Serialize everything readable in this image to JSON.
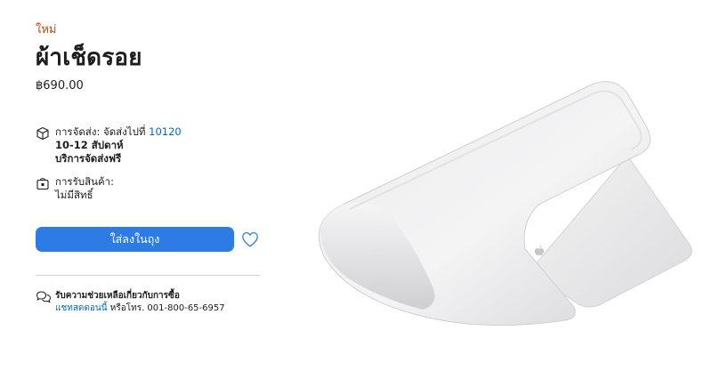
{
  "product": {
    "badge": "ใหม่",
    "title": "ผ้าเช็ดรอย",
    "price": "฿690.00"
  },
  "delivery": {
    "label": "การจัดส่ง: จัดส่งไปที่ ",
    "postcode": "10120",
    "timeframe": "10-12 สัปดาห์",
    "service": "บริการจัดส่งฟรี",
    "icon": "box-icon"
  },
  "pickup": {
    "label": "การรับสินค้า:",
    "status": "ไม่มีสิทธิ์",
    "icon": "shopping-bag-icon"
  },
  "actions": {
    "add_to_bag": "ใส่ลงในถุง",
    "favorite_icon": "heart-icon"
  },
  "help": {
    "heading": "รับความช่วยเหลือเกี่ยวกับการซื้อ",
    "chat_link": "แชทสดตอนนี้",
    "phone_text": " หรือโทร. 001-800-65-6957",
    "icon": "chat-bubbles-icon"
  },
  "colors": {
    "badge": "#bf4800",
    "button": "#2d7ce6",
    "link": "#0066cc"
  }
}
